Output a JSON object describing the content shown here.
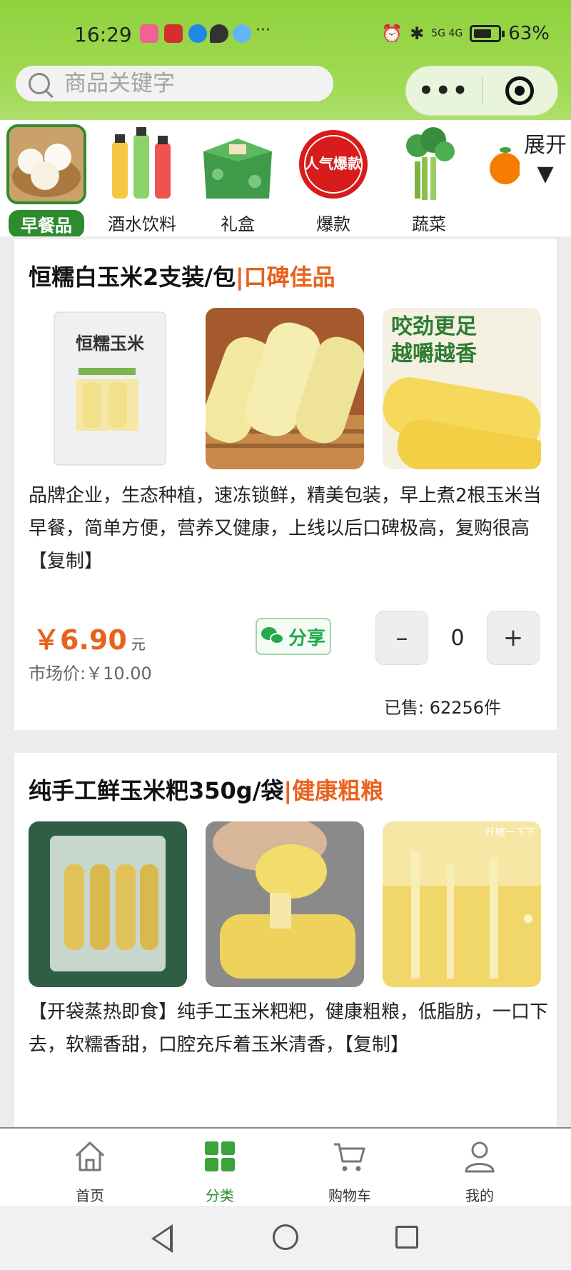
{
  "status_bar": {
    "time": "16:29",
    "ellipsis": "···",
    "network": "5G  4G",
    "battery": "63%"
  },
  "search": {
    "placeholder": "商品关键字"
  },
  "capsule": {
    "more": "•••"
  },
  "categories": [
    {
      "label": "早餐品",
      "active": true,
      "thumb": "steamed-buns"
    },
    {
      "label": "酒水饮料",
      "active": false,
      "thumb": "bottled-drinks"
    },
    {
      "label": "礼盒",
      "active": false,
      "thumb": "gift-box"
    },
    {
      "label": "爆款",
      "active": false,
      "thumb": "hot-seller-badge"
    },
    {
      "label": "蔬菜",
      "active": false,
      "thumb": "celery"
    }
  ],
  "expand_label": "展开▼",
  "hot_badge_text": "人气爆款",
  "products": [
    {
      "title": "恒糯白玉米2支装/包",
      "highlight": "|口碑佳品",
      "image_caption": "咬劲更足越嚼越香",
      "description": "品牌企业，生态种植，速冻锁鲜，精美包装，早上煮2根玉米当早餐，简单方便，营养又健康，上线以后口碑极高，复购很高【复制】",
      "price": "￥6.90",
      "price_unit": "元",
      "market_price": "市场价:￥10.00",
      "share_label": "分享",
      "quantity": "0",
      "sold": "已售:  62256件"
    },
    {
      "title": "纯手工鲜玉米粑350g/袋",
      "highlight": "|健康粗粮",
      "image_caption": "咔嚓一下下",
      "description": "【开袋蒸热即食】纯手工玉米粑粑，健康粗粮，低脂肪，一口下去，软糯香甜，口腔充斥着玉米清香，【复制】"
    }
  ],
  "stepper": {
    "minus": "–",
    "plus": "+"
  },
  "tabbar": [
    {
      "label": "首页",
      "icon": "home-icon",
      "active": false
    },
    {
      "label": "分类",
      "icon": "category-grid-icon",
      "active": true
    },
    {
      "label": "购物车",
      "icon": "cart-icon",
      "active": false
    },
    {
      "label": "我的",
      "icon": "user-icon",
      "active": false
    }
  ],
  "colors": {
    "header_green": "#8fd23c",
    "brand_green": "#2e8b2e",
    "highlight_orange": "#e8621e",
    "share_green": "#23a94b"
  }
}
